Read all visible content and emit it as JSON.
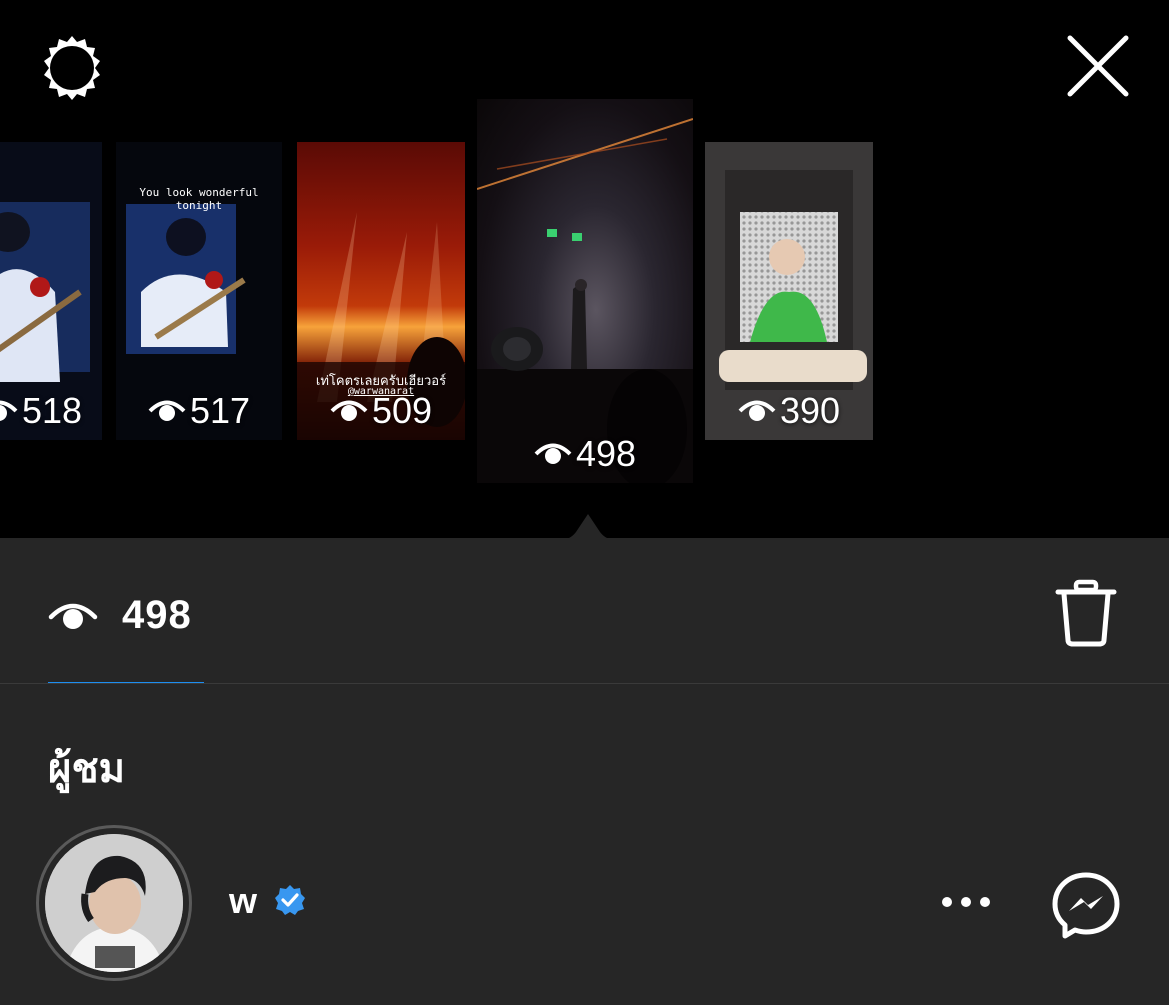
{
  "toolbar": {
    "settings_icon": "gear-icon",
    "close_icon": "close-icon"
  },
  "stories": [
    {
      "views": "518",
      "caption": ""
    },
    {
      "views": "517",
      "caption": "You look wonderful tonight"
    },
    {
      "views": "509",
      "caption": "เท่โคตรเลยครับเฮียวอร์",
      "mention": "@warwanarat"
    },
    {
      "views": "498",
      "caption": ""
    },
    {
      "views": "390",
      "caption": ""
    }
  ],
  "selected": {
    "views": "498",
    "delete_icon": "trash-icon"
  },
  "viewers_section": {
    "title": "ผู้ชม"
  },
  "viewer": {
    "name": "w",
    "verified": true,
    "more_icon": "more-icon",
    "message_icon": "messenger-icon"
  },
  "colors": {
    "background_top": "#000000",
    "sheet": "#262626",
    "tab_underline": "#1d8ef0",
    "verified": "#3897f0"
  }
}
